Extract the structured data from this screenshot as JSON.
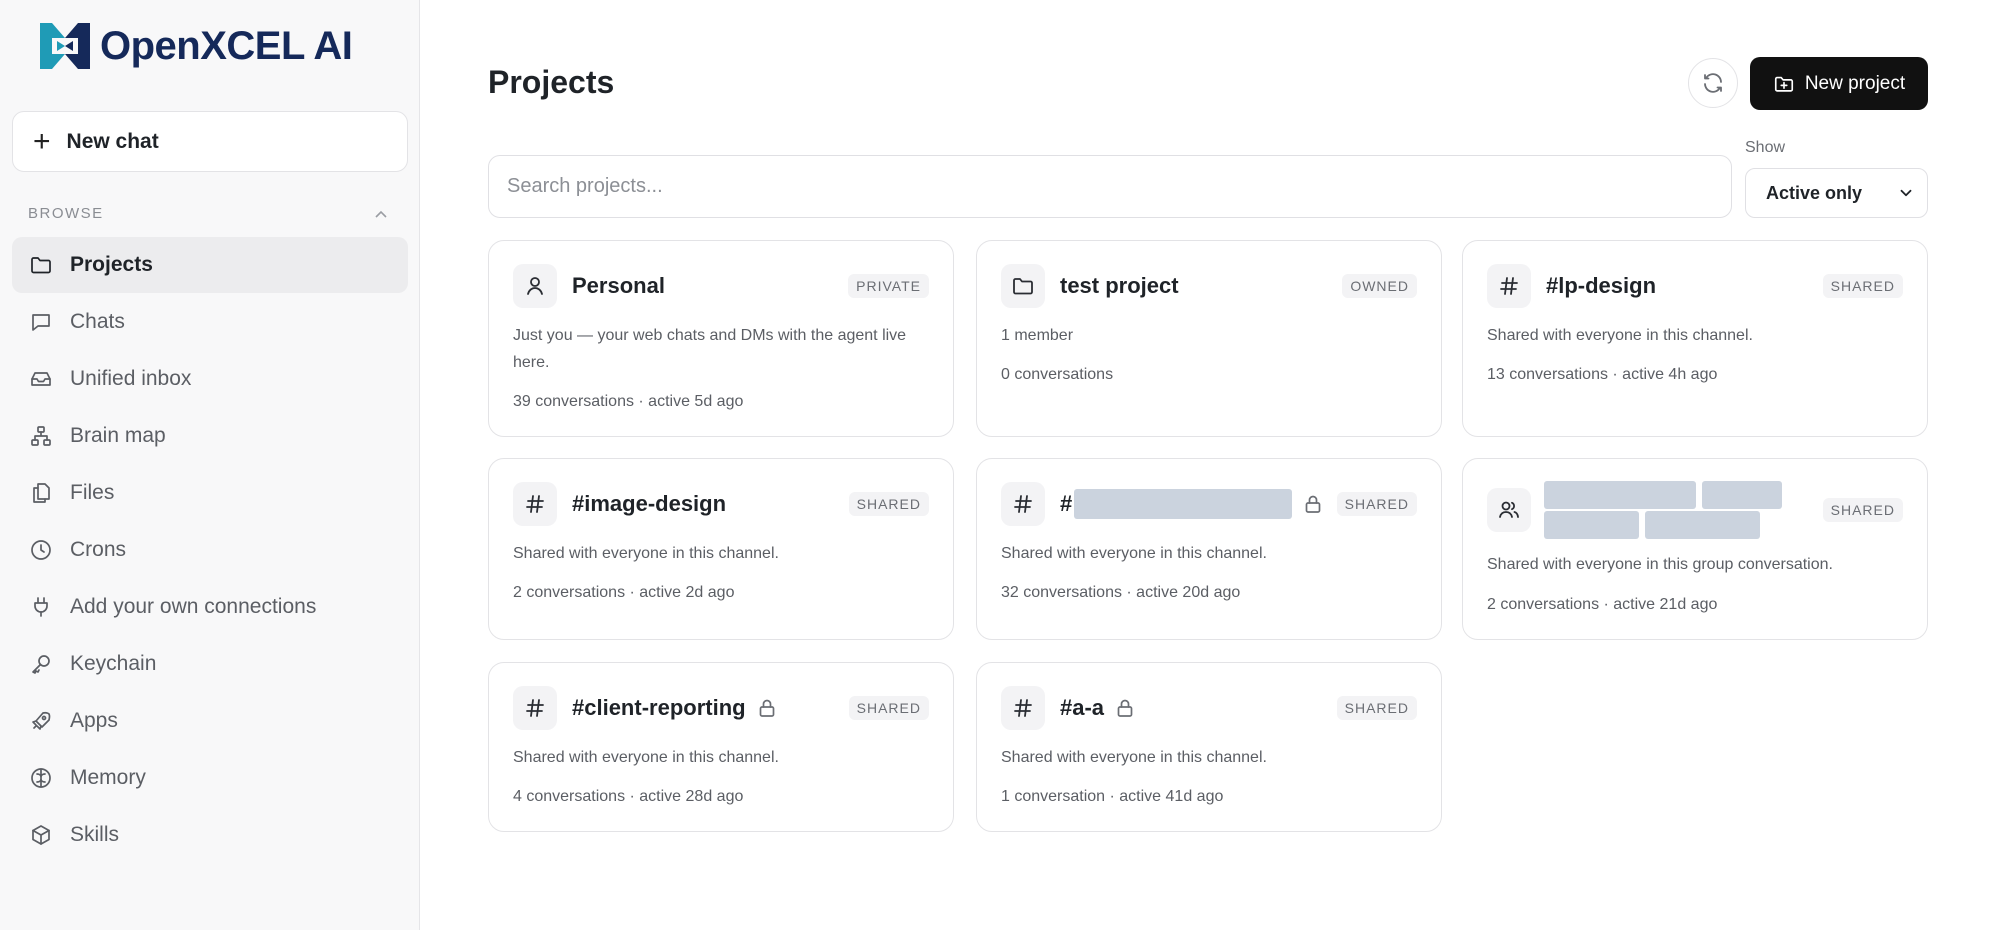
{
  "brand": {
    "name": "OpenXCEL AI",
    "colors": {
      "logo_primary": "#1f9bb6",
      "logo_dark": "#15295a"
    }
  },
  "sidebar": {
    "new_chat_label": "New chat",
    "section_label": "BROWSE",
    "items": [
      {
        "label": "Projects",
        "icon": "folder-icon",
        "active": true
      },
      {
        "label": "Chats",
        "icon": "chat-bubble-icon"
      },
      {
        "label": "Unified inbox",
        "icon": "inbox-icon"
      },
      {
        "label": "Brain map",
        "icon": "hierarchy-icon"
      },
      {
        "label": "Files",
        "icon": "files-icon"
      },
      {
        "label": "Crons",
        "icon": "clock-icon"
      },
      {
        "label": "Add your own connections",
        "icon": "plug-icon"
      },
      {
        "label": "Keychain",
        "icon": "key-icon"
      },
      {
        "label": "Apps",
        "icon": "rocket-icon"
      },
      {
        "label": "Memory",
        "icon": "brain-icon"
      },
      {
        "label": "Skills",
        "icon": "cube-icon"
      }
    ]
  },
  "header": {
    "title": "Projects",
    "new_project_label": "New project"
  },
  "search": {
    "placeholder": "Search projects..."
  },
  "filter": {
    "label": "Show",
    "value": "Active only"
  },
  "projects": [
    {
      "name": "Personal",
      "icon": "user-icon",
      "badge": "PRIVATE",
      "description": "Just you — your web chats and DMs with the agent live here.",
      "meta": "39 conversations · active 5d ago"
    },
    {
      "name": "test project",
      "icon": "folder-icon",
      "badge": "OWNED",
      "description": "1 member",
      "meta": "0 conversations"
    },
    {
      "name": "#lp-design",
      "icon": "hash-icon",
      "badge": "SHARED",
      "description": "Shared with everyone in this channel.",
      "meta": "13 conversations · active 4h ago"
    },
    {
      "name": "#image-design",
      "icon": "hash-icon",
      "badge": "SHARED",
      "description": "Shared with everyone in this channel.",
      "meta": "2 conversations · active 2d ago"
    },
    {
      "name": "#",
      "icon": "hash-icon",
      "badge": "SHARED",
      "locked": true,
      "redacted": true,
      "description": "Shared with everyone in this channel.",
      "meta": "32 conversations · active 20d ago"
    },
    {
      "name": "",
      "icon": "users-icon",
      "badge": "SHARED",
      "redacted": true,
      "description": "Shared with everyone in this group conversation.",
      "meta": "2 conversations · active 21d ago"
    },
    {
      "name": "#client-reporting",
      "icon": "hash-icon",
      "badge": "SHARED",
      "locked": true,
      "description": "Shared with everyone in this channel.",
      "meta": "4 conversations · active 28d ago"
    },
    {
      "name": "#a-a",
      "icon": "hash-icon",
      "badge": "SHARED",
      "locked": true,
      "description": "Shared with everyone in this channel.",
      "meta": "1 conversation · active 41d ago"
    }
  ]
}
